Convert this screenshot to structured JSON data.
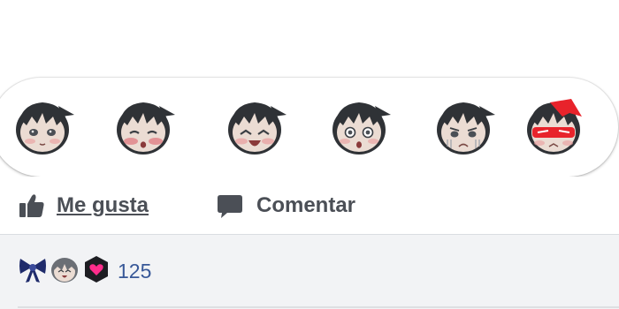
{
  "reactions": [
    {
      "name": "like",
      "icon": "chibi-neutral-icon"
    },
    {
      "name": "love",
      "icon": "chibi-blush-icon"
    },
    {
      "name": "haha",
      "icon": "chibi-laugh-icon"
    },
    {
      "name": "wow",
      "icon": "chibi-surprised-icon"
    },
    {
      "name": "sad",
      "icon": "chibi-sad-icon"
    },
    {
      "name": "angry",
      "icon": "chibi-angry-icon"
    }
  ],
  "actions": {
    "like_label": "Me gusta",
    "comment_label": "Comentar",
    "like_icon": "thumbs-up-icon",
    "comment_icon": "speech-bubble-icon"
  },
  "summary": {
    "count": "125",
    "icons": [
      "bow-icon",
      "chibi-face-icon",
      "heart-badge-icon"
    ]
  },
  "colors": {
    "action_text": "#4b4f56",
    "count_text": "#385898",
    "summary_bg": "#f2f3f5",
    "angry_red": "#e8232b",
    "bow_navy": "#1f2b6b",
    "heart_pink": "#ff2d8c"
  }
}
